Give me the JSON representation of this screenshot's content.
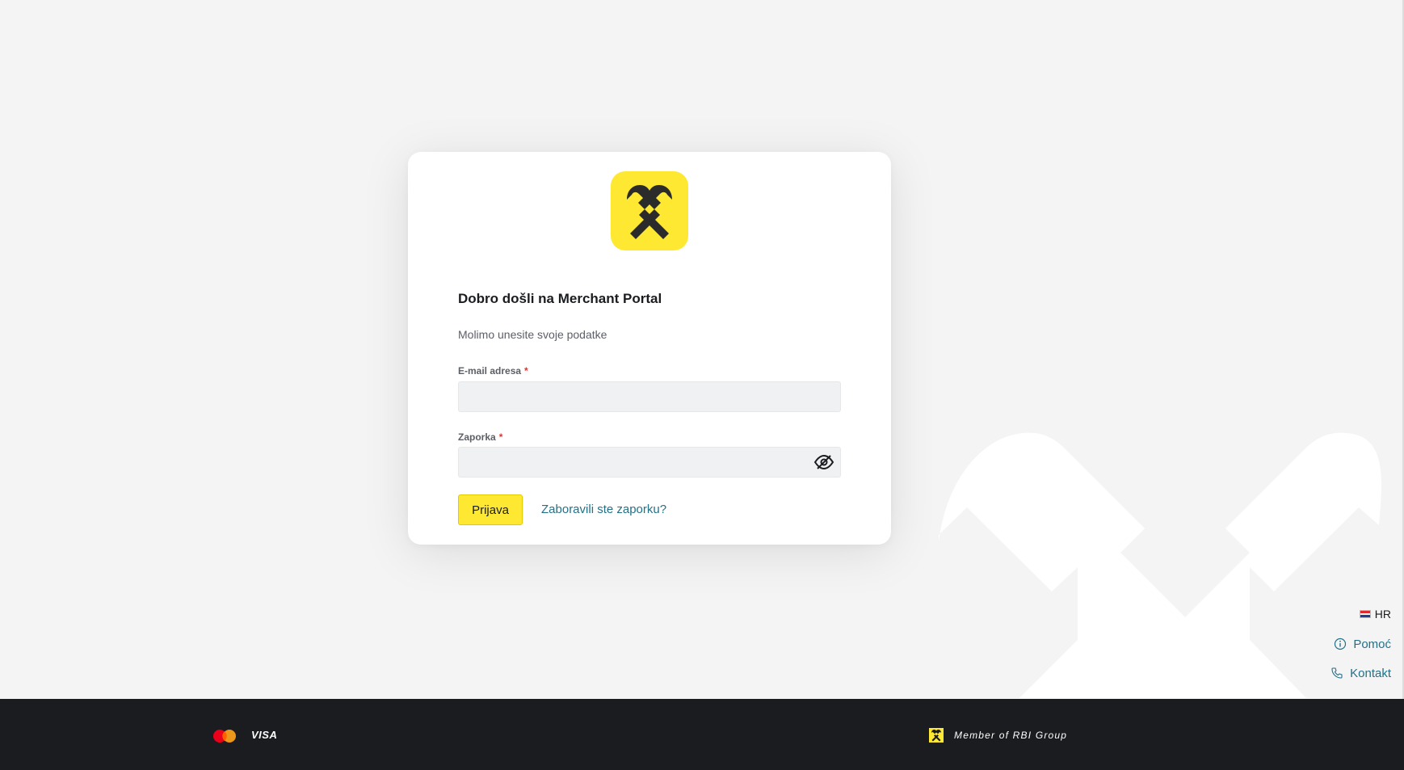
{
  "login": {
    "title": "Dobro došli na Merchant Portal",
    "subtitle": "Molimo unesite svoje podatke",
    "email_label": "E-mail adresa",
    "email_value": "",
    "password_label": "Zaporka",
    "password_value": "",
    "required_marker": "*",
    "submit_label": "Prijava",
    "forgot_label": "Zaboravili ste zaporku?"
  },
  "side": {
    "language": "HR",
    "help_label": "Pomoć",
    "contact_label": "Kontakt"
  },
  "footer": {
    "card_brand": "VISA",
    "member_text": "Member of RBI Group"
  },
  "icons": {
    "brand_logo": "raiffeisen-crossed-horse-heads-icon",
    "password_toggle": "eye-slash-icon",
    "help": "info-icon",
    "contact": "phone-icon",
    "card_brand_logo": "mastercard-icon"
  },
  "colors": {
    "brand_yellow": "#fee832",
    "link": "#237188",
    "footer_bg": "#1b1c20",
    "page_bg": "#f4f4f4"
  }
}
